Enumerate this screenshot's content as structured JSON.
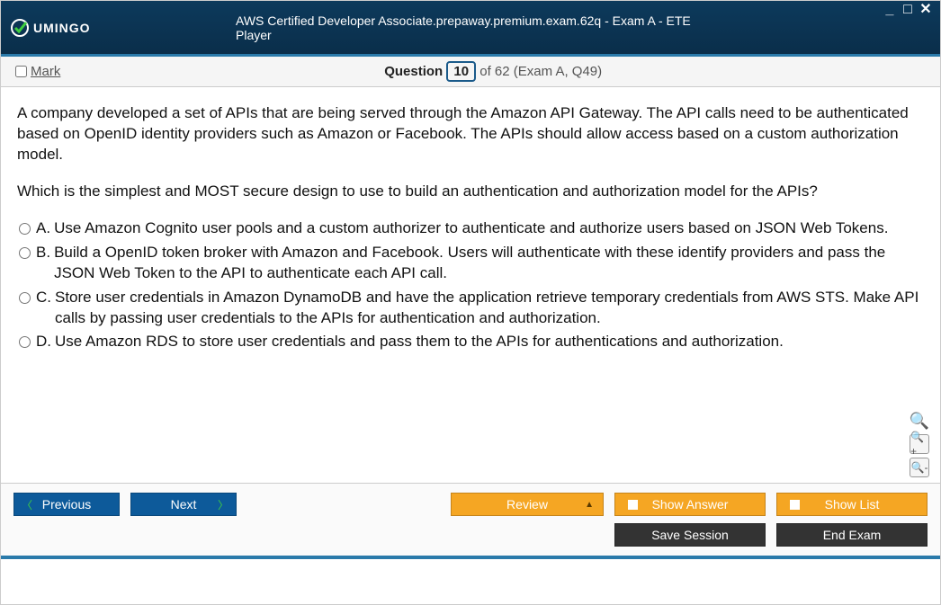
{
  "titlebar": {
    "logo_text": "UMINGO",
    "title": "AWS Certified Developer Associate.prepaway.premium.exam.62q - Exam A - ETE Player"
  },
  "header": {
    "mark_label": "Mark",
    "question_label": "Question",
    "question_number": "10",
    "question_total": "of 62 (Exam A, Q49)"
  },
  "question": {
    "paragraphs": [
      "A company developed a set of APIs that are being served through the Amazon API Gateway. The API calls need to be authenticated based on OpenID identity providers such as Amazon or Facebook. The APIs should allow access based on a custom authorization model.",
      "Which is the simplest and MOST secure design to use to build an authentication and authorization model for the APIs?"
    ],
    "answers": [
      {
        "letter": "A.",
        "text": "Use Amazon Cognito user pools and a custom authorizer to authenticate and authorize users based on JSON Web Tokens."
      },
      {
        "letter": "B.",
        "text": "Build a OpenID token broker with Amazon and Facebook. Users will authenticate with these identify providers and pass the JSON Web Token to the API to authenticate each API call."
      },
      {
        "letter": "C.",
        "text": "Store user credentials in Amazon DynamoDB and have the application retrieve temporary credentials from AWS STS. Make API calls by passing user credentials to the APIs for authentication and authorization."
      },
      {
        "letter": "D.",
        "text": "Use Amazon RDS to store user credentials and pass them to the APIs for authentications and authorization."
      }
    ]
  },
  "footer": {
    "previous": "Previous",
    "next": "Next",
    "review": "Review",
    "show_answer": "Show Answer",
    "show_list": "Show List",
    "save_session": "Save Session",
    "end_exam": "End Exam"
  }
}
